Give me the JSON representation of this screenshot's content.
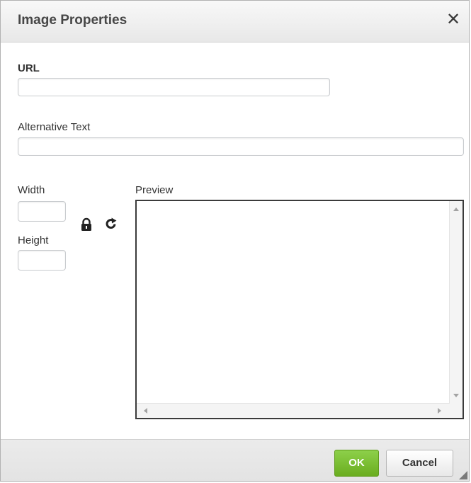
{
  "dialog": {
    "title": "Image Properties",
    "close_icon": "close-icon"
  },
  "form": {
    "url_label": "URL",
    "url_value": "",
    "alt_label": "Alternative Text",
    "alt_value": "",
    "width_label": "Width",
    "width_value": "",
    "height_label": "Height",
    "height_value": "",
    "lock_icon": "lock-icon",
    "reset_icon": "reset-size-icon",
    "preview_label": "Preview"
  },
  "footer": {
    "ok_label": "OK",
    "cancel_label": "Cancel"
  },
  "colors": {
    "ok_button": "#7abf2f",
    "titlebar": "#f1f1f1"
  }
}
